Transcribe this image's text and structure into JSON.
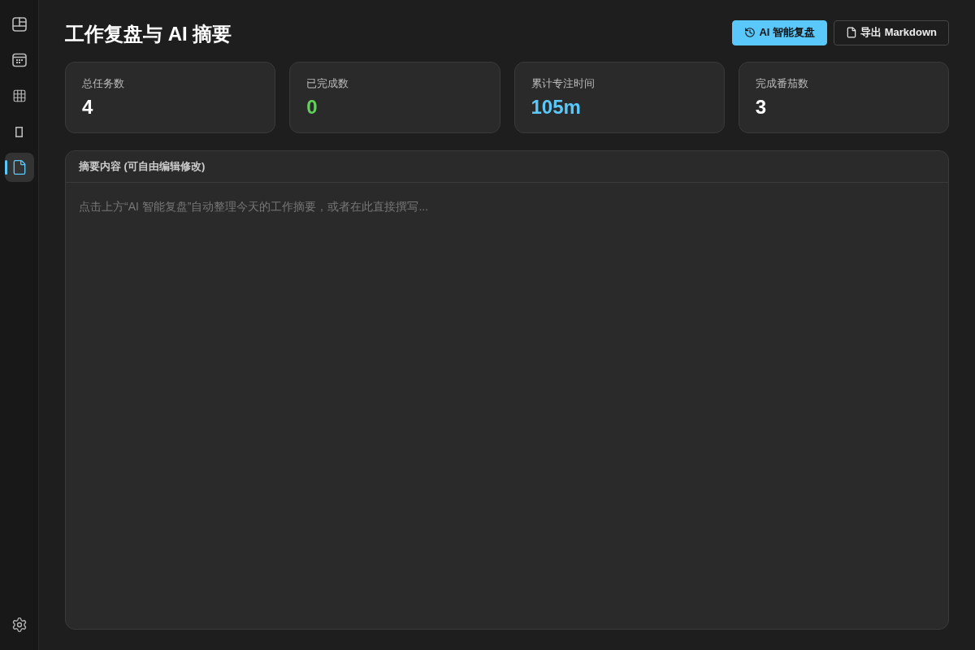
{
  "sidebar": {
    "items": [
      {
        "selected": false
      },
      {
        "selected": false
      },
      {
        "selected": false
      },
      {
        "selected": false
      },
      {
        "selected": true
      }
    ]
  },
  "header": {
    "title": "工作复盘与 AI 摘要",
    "buttons": [
      {
        "label": "AI 智能复盘",
        "kind": "primary"
      },
      {
        "label": "导出 Markdown",
        "kind": "secondary"
      }
    ]
  },
  "stats": [
    {
      "label": "总任务数",
      "value": "4",
      "color": "#ffffff"
    },
    {
      "label": "已完成数",
      "value": "0",
      "color": "#62d05a"
    },
    {
      "label": "累计专注时间",
      "value": "105m",
      "color": "#5ac8fa"
    },
    {
      "label": "完成番茄数",
      "value": "3",
      "color": "#ffffff"
    }
  ],
  "summary": {
    "title": "摘要内容 (可自由编辑修改)",
    "placeholder": "点击上方“AI 智能复盘”自动整理今天的工作摘要，或者在此直接撰写..."
  }
}
